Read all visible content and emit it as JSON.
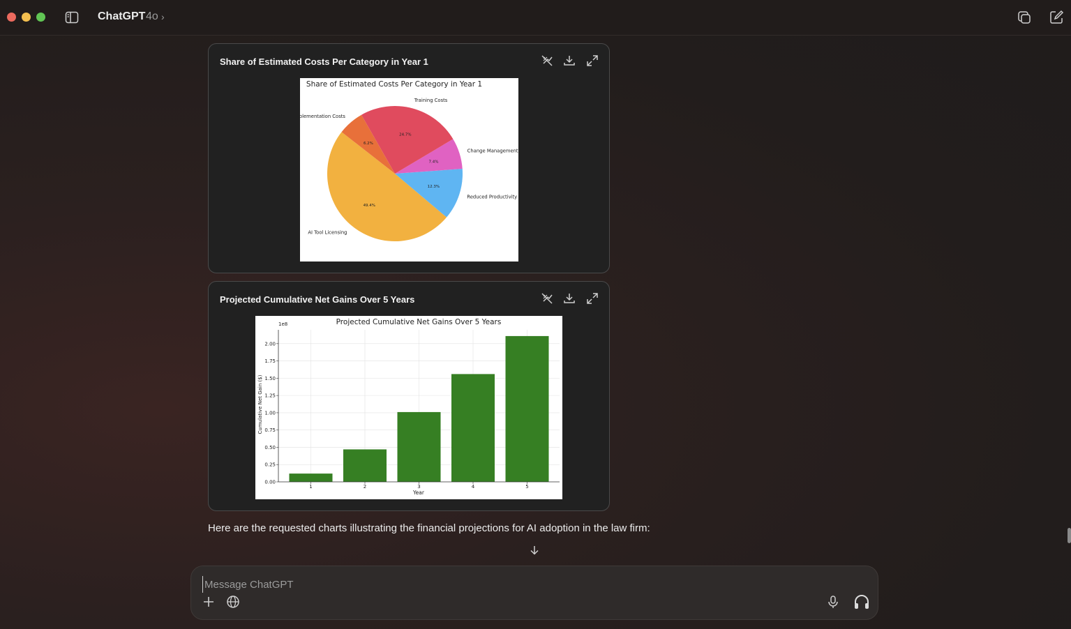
{
  "window": {
    "app_title": "ChatGPT",
    "model": "4o",
    "model_chevron": "›",
    "icons": [
      "sidebar-toggle-icon",
      "new-window-icon",
      "new-chat-icon"
    ]
  },
  "cards": [
    {
      "title": "Share of Estimated Costs Per Category in Year 1",
      "actions": [
        "toggle-interactive-icon",
        "download-icon",
        "expand-icon"
      ]
    },
    {
      "title": "Projected Cumulative Net Gains Over 5 Years",
      "actions": [
        "toggle-interactive-icon",
        "download-icon",
        "expand-icon"
      ]
    }
  ],
  "chart_data": [
    {
      "type": "pie",
      "title": "Share of Estimated Costs Per Category in Year 1",
      "slices": [
        {
          "label": "AI Tool Licensing",
          "value": 49.4,
          "pct_label": "49.4%",
          "color": "#f2b140"
        },
        {
          "label": "Reduced Productivity",
          "value": 12.3,
          "pct_label": "12.3%",
          "color": "#5fb5f2"
        },
        {
          "label": "Change Management",
          "value": 7.4,
          "pct_label": "7.4%",
          "color": "#e062c2"
        },
        {
          "label": "Training Costs",
          "value": 24.7,
          "pct_label": "24.7%",
          "color": "#e04b5e"
        },
        {
          "label": "Implementation Costs",
          "value": 6.2,
          "pct_label": "6.2%",
          "color": "#e8703a"
        }
      ]
    },
    {
      "type": "bar",
      "title": "Projected Cumulative Net Gains Over 5 Years",
      "xlabel": "Year",
      "ylabel": "Cumulative Net Gain ($)",
      "y_offset_label": "1e8",
      "categories": [
        "1",
        "2",
        "3",
        "4",
        "5"
      ],
      "values": [
        0.12,
        0.47,
        1.01,
        1.56,
        2.11
      ],
      "ylim": [
        0,
        2.2
      ],
      "yticks": [
        "0.00",
        "0.25",
        "0.50",
        "0.75",
        "1.00",
        "1.25",
        "1.50",
        "1.75",
        "2.00"
      ],
      "grid": true,
      "bar_color": "#367f23"
    }
  ],
  "message": {
    "text": "Here are the requested charts illustrating the financial projections for AI adoption in the law firm:"
  },
  "composer": {
    "placeholder": "Message ChatGPT",
    "icons": [
      "plus-icon",
      "globe-icon",
      "microphone-icon",
      "headphones-icon"
    ]
  },
  "colors": {
    "background": "#221d1c",
    "card": "#212121",
    "bar": "#367f23"
  }
}
